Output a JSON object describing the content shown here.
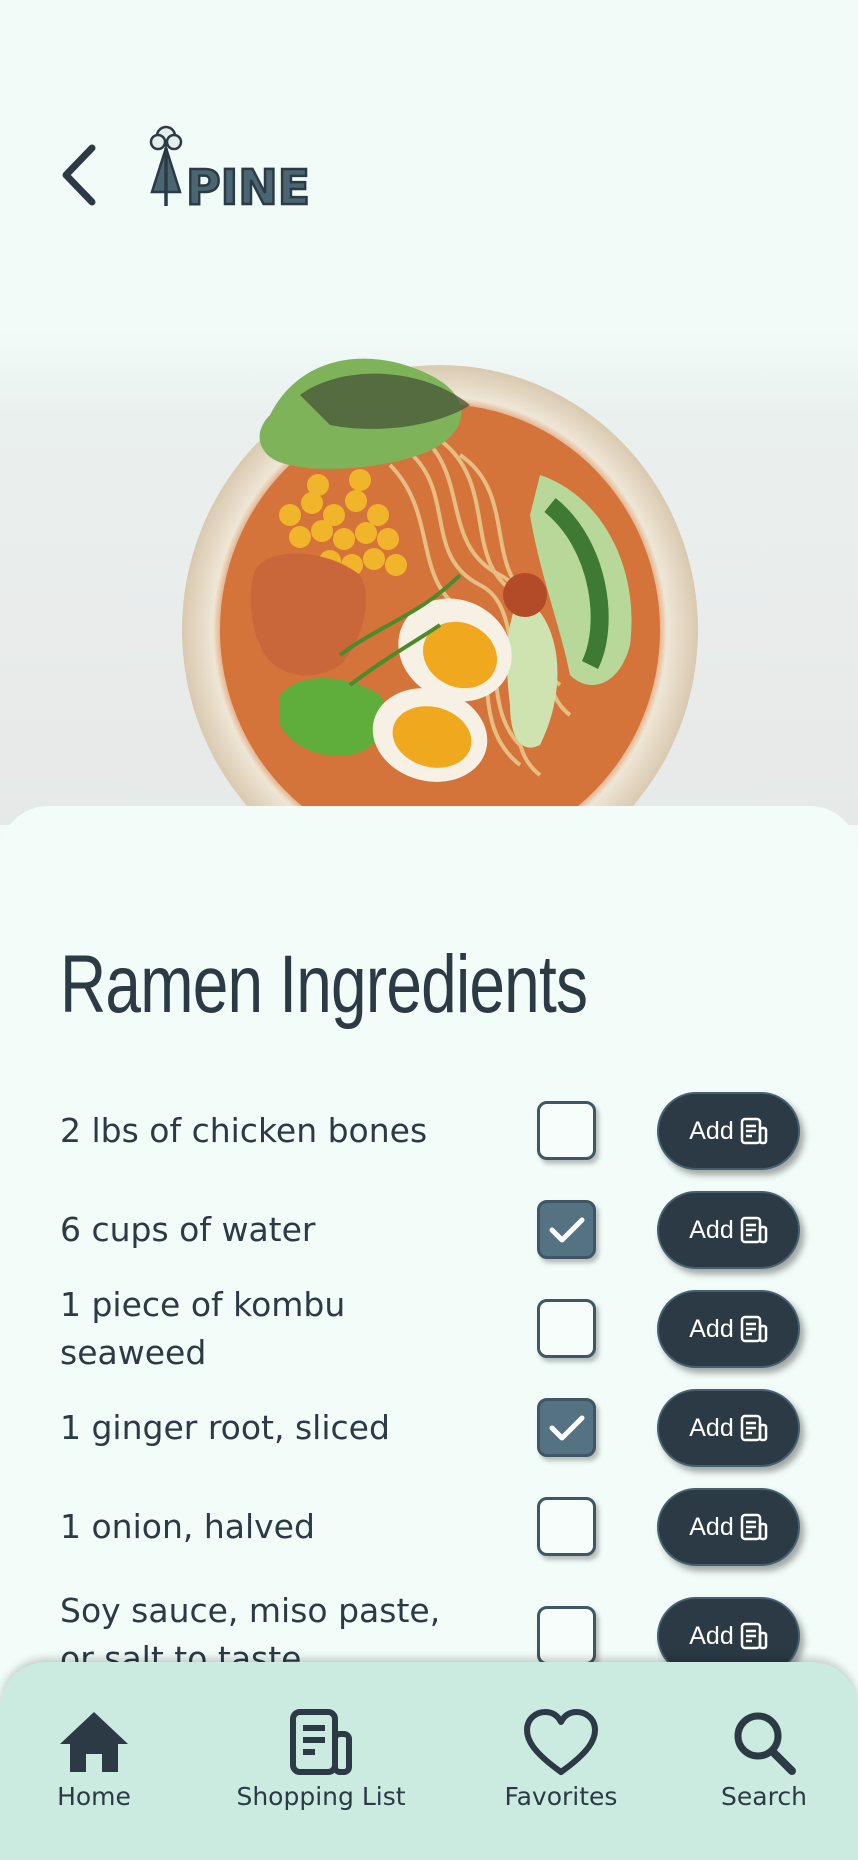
{
  "header": {
    "back_icon": "chevron-left-icon",
    "logo_text": "PINE",
    "logo_icon": "tree-icon"
  },
  "hero": {
    "image": "ramen-bowl-photo"
  },
  "recipe": {
    "title": "Ramen Ingredients",
    "add_label": "Add",
    "add_icon": "shopping-list-icon",
    "ingredients": [
      {
        "name": "2 lbs of chicken bones",
        "checked": false
      },
      {
        "name": "6 cups of water",
        "checked": true
      },
      {
        "name": "1 piece of kombu seaweed",
        "checked": false
      },
      {
        "name": "1 ginger root, sliced",
        "checked": true
      },
      {
        "name": "1 onion, halved",
        "checked": false
      },
      {
        "name": "Soy sauce, miso paste, or salt to taste",
        "checked": false
      }
    ]
  },
  "nav": {
    "items": [
      {
        "label": "Home",
        "icon": "home-icon"
      },
      {
        "label": "Shopping List",
        "icon": "shopping-list-icon"
      },
      {
        "label": "Favorites",
        "icon": "heart-icon"
      },
      {
        "label": "Search",
        "icon": "search-icon"
      }
    ]
  },
  "colors": {
    "primary": "#2b3a45",
    "background": "#f1fcf8",
    "nav_background": "#cbeae0",
    "checked": "#557282"
  }
}
